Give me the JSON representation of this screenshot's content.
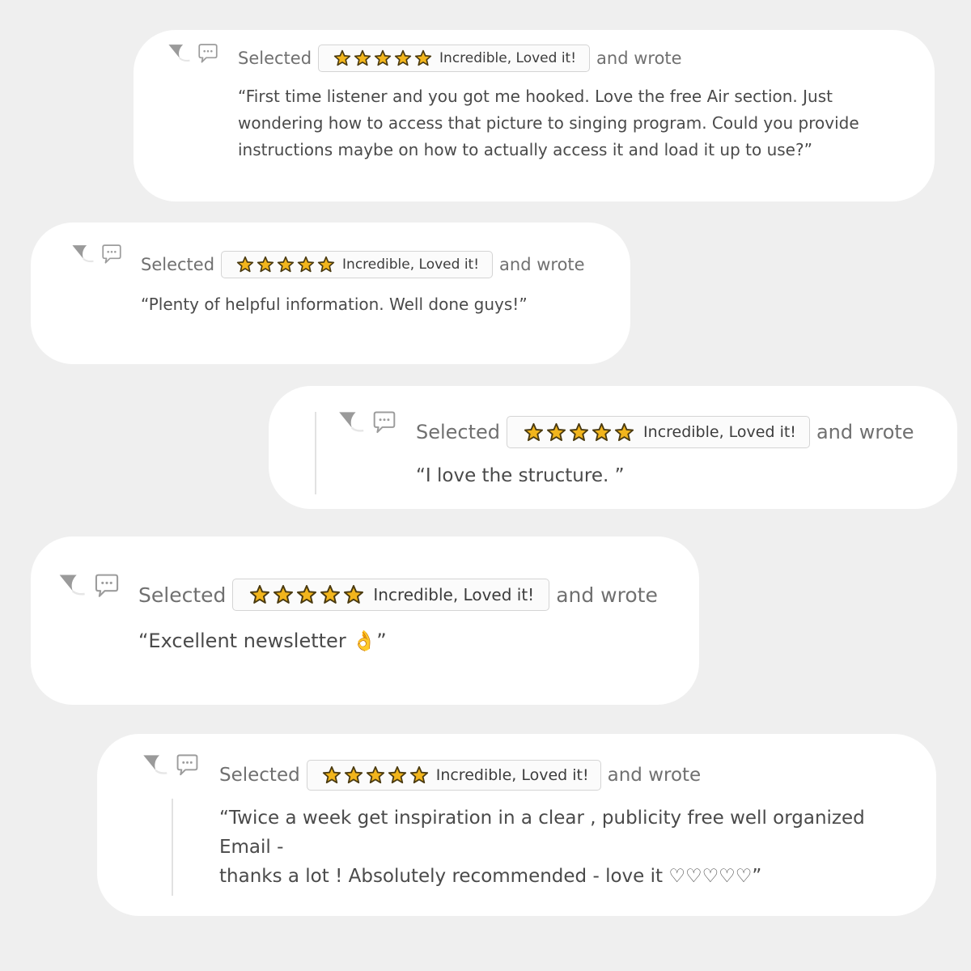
{
  "colors": {
    "background": "#efefef",
    "card": "#ffffff",
    "star_fill": "#f2b51c",
    "star_outline": "#4a3a10"
  },
  "icons": {
    "flag": "flag-icon",
    "comment": "speech-bubble-icon",
    "star": "star-icon"
  },
  "reviews": [
    {
      "selected_label": "Selected",
      "rating": {
        "stars": 5,
        "label": "Incredible, Loved it!"
      },
      "wrote_label": "and wrote",
      "text": "“First time listener and you got me hooked. Love the free Air section. Just\nwondering how to access that picture to singing program. Could you provide\ninstructions maybe on how to actually access it and load it up to use?”"
    },
    {
      "selected_label": "Selected",
      "rating": {
        "stars": 5,
        "label": "Incredible, Loved it!"
      },
      "wrote_label": "and wrote",
      "text": "“Plenty of helpful information. Well done guys!”"
    },
    {
      "selected_label": "Selected",
      "rating": {
        "stars": 5,
        "label": "Incredible, Loved it!"
      },
      "wrote_label": "and wrote",
      "text": "“I love the structure. ”"
    },
    {
      "selected_label": "Selected",
      "rating": {
        "stars": 5,
        "label": "Incredible, Loved it!"
      },
      "wrote_label": "and wrote",
      "text": "“Excellent newsletter 👌”"
    },
    {
      "selected_label": "Selected",
      "rating": {
        "stars": 5,
        "label": "Incredible, Loved it!"
      },
      "wrote_label": "and wrote",
      "text": "“Twice a week get inspiration in a clear , publicity free well organized Email -\nthanks a lot ! Absolutely recommended - love it ♡♡♡♡♡”"
    }
  ]
}
